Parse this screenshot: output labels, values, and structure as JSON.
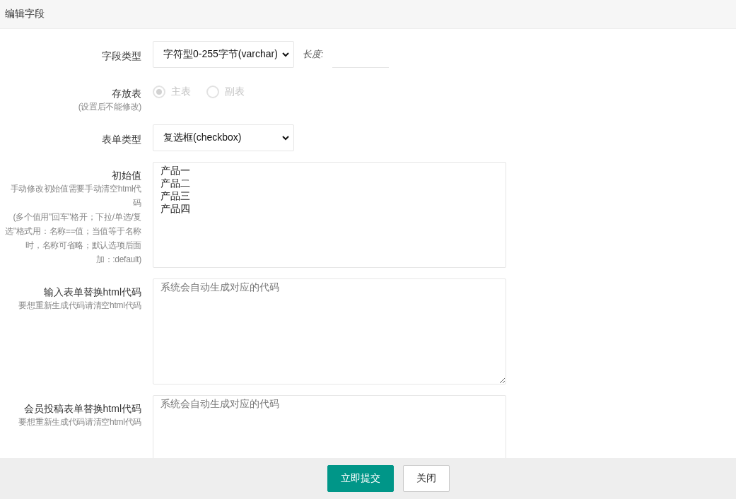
{
  "header": {
    "title": "编辑字段"
  },
  "rows": [
    {
      "kind": "select",
      "label": "字段类型",
      "value": "字符型0-255字节(varchar)",
      "extra_label": "长度:",
      "extra_value": ""
    },
    {
      "kind": "radio",
      "label": "存放表",
      "hints": [
        "(设置后不能修改)"
      ],
      "disabled": true,
      "options": [
        {
          "label": "主表",
          "selected": true
        },
        {
          "label": "副表",
          "selected": false
        }
      ]
    },
    {
      "kind": "select",
      "label": "表单类型",
      "value": "复选框(checkbox)"
    },
    {
      "kind": "textarea",
      "label": "初始值",
      "hints": [
        "手动修改初始值需要手动清空html代码",
        "(多个值用\"回车\"格开；下拉/单选/复选\"格式用：名称==值；当值等于名称时，名称可省略；默认选项后面加：:default)"
      ],
      "lines": [
        "产品一",
        "产品二",
        "产品三",
        "产品四"
      ]
    },
    {
      "kind": "textarea",
      "label": "输入表单替换html代码",
      "hints": [
        "要想重新生成代码请清空html代码"
      ],
      "placeholder": "系统会自动生成对应的代码"
    },
    {
      "kind": "textarea",
      "label": "会员投稿表单替换html代码",
      "hints": [
        "要想重新生成代码请清空html代码"
      ],
      "placeholder": "系统会自动生成对应的代码"
    }
  ],
  "buttons": [
    {
      "label": "立即提交",
      "kind": "primary"
    },
    {
      "label": "关闭",
      "kind": "default"
    }
  ]
}
